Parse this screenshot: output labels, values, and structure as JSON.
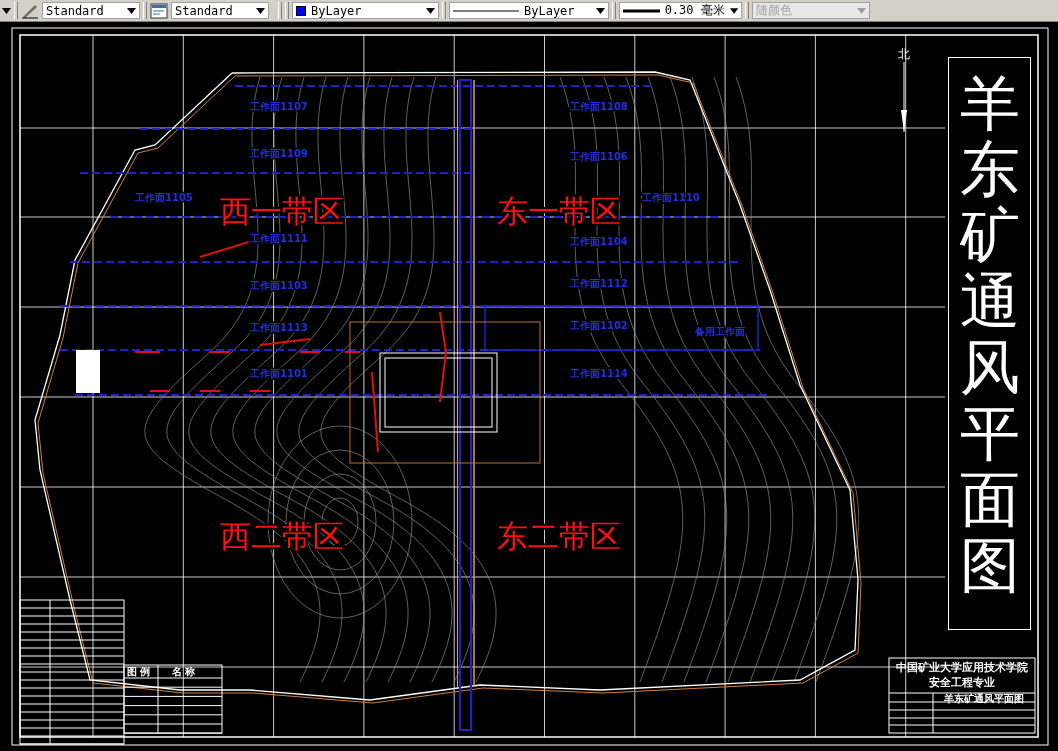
{
  "toolbar": [
    {
      "kind": "textstyle",
      "value": "Standard",
      "disabled": false
    },
    {
      "kind": "dimstyle",
      "value": "Standard",
      "disabled": false
    },
    {
      "kind": "color",
      "value": "ByLayer",
      "color": "#0000ff",
      "disabled": false
    },
    {
      "kind": "linetype",
      "value": "ByLayer",
      "disabled": false
    },
    {
      "kind": "lineweight",
      "value": "0.30 毫米",
      "disabled": false
    },
    {
      "kind": "plotstyle",
      "value": "随颜色",
      "disabled": true
    }
  ],
  "drawing": {
    "north": "北",
    "title": "羊东矿通风平面图",
    "zones": [
      "西一带区",
      "东一带区",
      "西二带区",
      "东二带区"
    ],
    "faces": [
      "工作面1107",
      "工作面1109",
      "工作面1105",
      "工作面1111",
      "工作面1103",
      "工作面1113",
      "工作面1101",
      "工作面1108",
      "工作面1106",
      "工作面1110",
      "工作面1104",
      "工作面1112",
      "工作面1102",
      "工作面1114",
      "备用工作面"
    ],
    "legend": {
      "headers": [
        "图 例",
        "名 称"
      ]
    },
    "title_block": {
      "school": "中国矿业大学应用技术学院",
      "major": "安全工程专业",
      "drawing_name": "羊东矿通风平面图"
    }
  }
}
